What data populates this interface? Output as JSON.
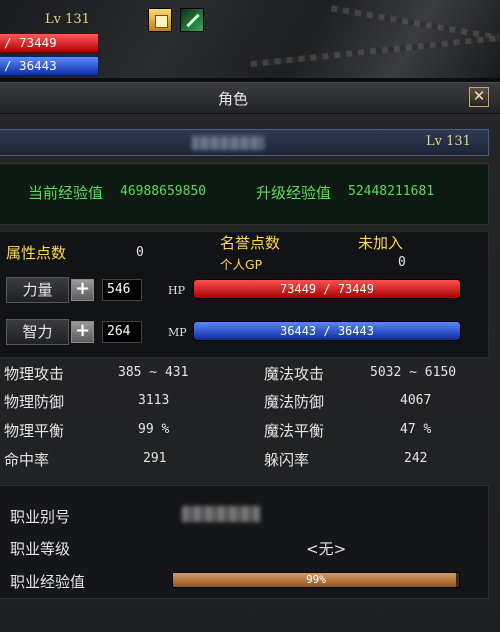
{
  "hud": {
    "level": "Lv 131",
    "hp_text": "/ 73449",
    "mp_text": "/ 36443"
  },
  "window": {
    "title": "角色",
    "close_glyph": "✕",
    "level": "Lv 131"
  },
  "experience": {
    "current_label": "当前经验值",
    "current_value": "46988659850",
    "next_label": "升级经验值",
    "next_value": "52448211681"
  },
  "attributes": {
    "points_label": "属性点数",
    "points_value": "0",
    "reputation_label": "名誉点数",
    "reputation_status": "未加入",
    "gp_label": "个人GP",
    "gp_value": "0"
  },
  "strength": {
    "label": "力量",
    "plus": "+",
    "value": "546",
    "bar_tag": "HP",
    "bar_text": "73449 / 73449",
    "fill": 1.0,
    "color_top": "#ff5050",
    "color_bottom": "#a80000"
  },
  "intelligence": {
    "label": "智力",
    "plus": "+",
    "value": "264",
    "bar_tag": "MP",
    "bar_text": "36443 / 36443",
    "fill": 1.0,
    "color_top": "#5a86ff",
    "color_bottom": "#0d2a9a"
  },
  "stats": {
    "left": [
      {
        "label": "物理攻击",
        "value": "385 ~ 431"
      },
      {
        "label": "物理防御",
        "value": "3113"
      },
      {
        "label": "物理平衡",
        "value": "99 %"
      },
      {
        "label": "命中率",
        "value": "291"
      }
    ],
    "right": [
      {
        "label": "魔法攻击",
        "value": "5032 ~ 6150"
      },
      {
        "label": "魔法防御",
        "value": "4067"
      },
      {
        "label": "魔法平衡",
        "value": "47 %"
      },
      {
        "label": "躲闪率",
        "value": "242"
      }
    ]
  },
  "job": {
    "alias_label": "职业别号",
    "grade_label": "职业等级",
    "grade_value": "<无>",
    "exp_label": "职业经验值",
    "exp_text": "99%",
    "exp_fill": 0.99
  }
}
